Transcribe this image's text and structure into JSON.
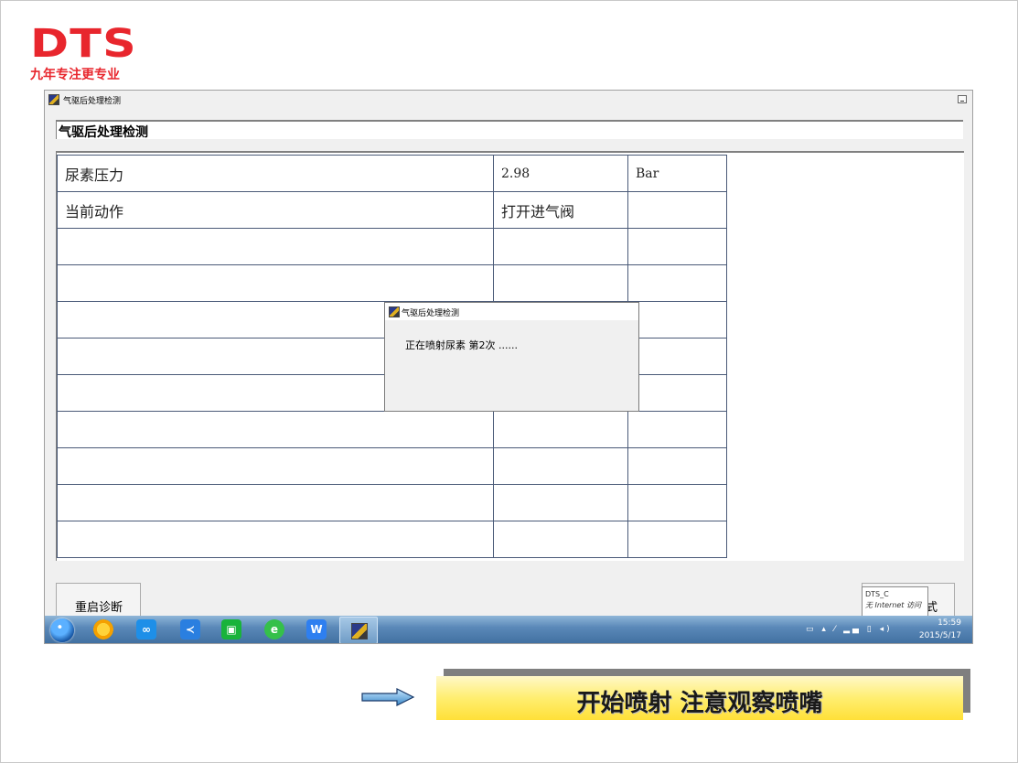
{
  "logo": {
    "brand": "DTS",
    "slogan": "九年专注更专业",
    "color": "#e8262d"
  },
  "window": {
    "title": "气驱后处理检测",
    "header": "气驱后处理检测"
  },
  "table": {
    "rows": [
      [
        "尿素压力",
        "2.98",
        "Bar"
      ],
      [
        "当前动作",
        "打开进气阀",
        ""
      ],
      [
        "",
        "",
        ""
      ],
      [
        "",
        "",
        ""
      ],
      [
        "",
        "",
        ""
      ],
      [
        "",
        "",
        ""
      ],
      [
        "",
        "",
        ""
      ],
      [
        "",
        "",
        ""
      ],
      [
        "",
        "",
        ""
      ],
      [
        "",
        "",
        ""
      ],
      [
        "",
        "",
        ""
      ]
    ]
  },
  "dialog": {
    "title": "气驱后处理检测",
    "message": "正在喷射尿素 第2次 ......"
  },
  "buttons": {
    "restart": "重启诊断",
    "right_partial": "式"
  },
  "tooltip": {
    "line1": "DTS_C",
    "line2": "无 Internet 访问"
  },
  "taskbar": {
    "time": "15:59",
    "date": "2015/5/17"
  },
  "caption": {
    "text": "开始喷射 注意观察喷嘴"
  }
}
